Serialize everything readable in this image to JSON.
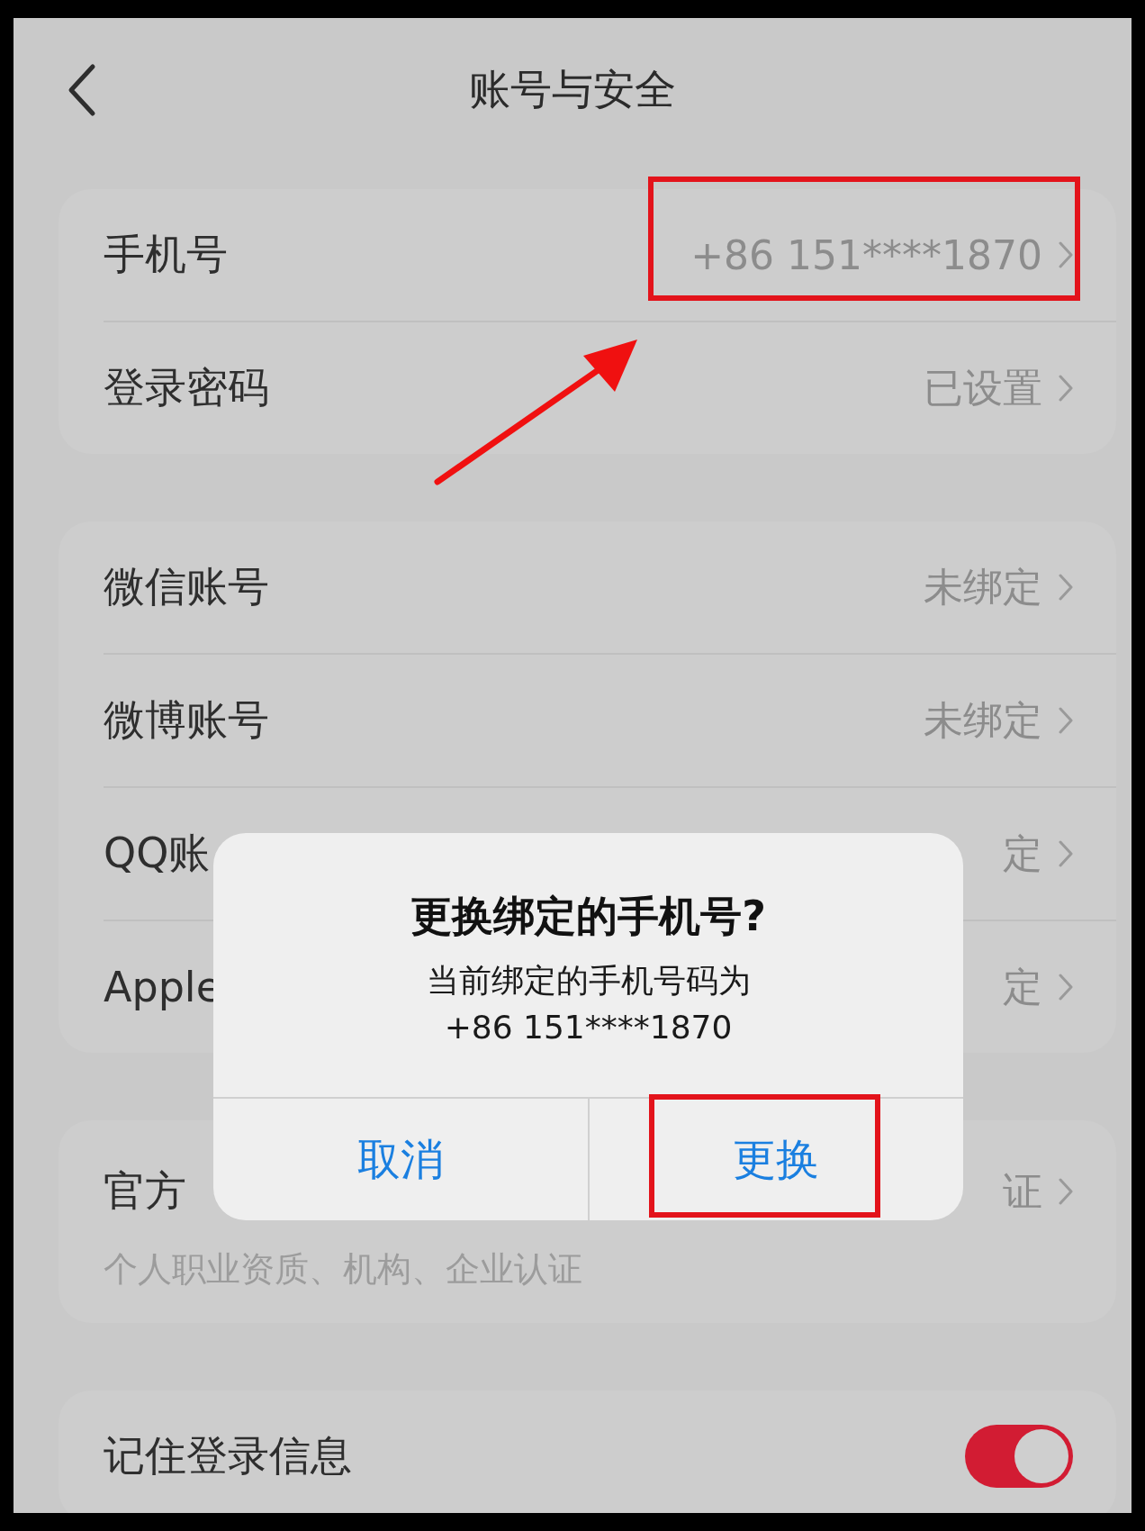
{
  "header": {
    "title": "账号与安全"
  },
  "groups": [
    {
      "rows": [
        {
          "kind": "link",
          "label": "手机号",
          "value": "+86 151****1870"
        },
        {
          "kind": "link",
          "label": "登录密码",
          "value": "已设置"
        }
      ]
    },
    {
      "rows": [
        {
          "kind": "link",
          "label": "微信账号",
          "value": "未绑定"
        },
        {
          "kind": "link",
          "label": "微博账号",
          "value": "未绑定"
        },
        {
          "kind": "link",
          "label": "QQ账",
          "value": "定"
        },
        {
          "kind": "link",
          "label": "Apple",
          "value": "定"
        }
      ]
    },
    {
      "rows": [
        {
          "kind": "link",
          "label": "官方",
          "value": "证",
          "subtitle": "个人职业资质、机构、企业认证"
        }
      ]
    },
    {
      "rows": [
        {
          "kind": "toggle",
          "label": "记住登录信息",
          "on": true
        }
      ]
    }
  ],
  "dialog": {
    "title": "更换绑定的手机号?",
    "message": "当前绑定的手机号码为",
    "phone": "+86 151****1870",
    "buttons": [
      {
        "label": "取消"
      },
      {
        "label": "更换"
      }
    ]
  }
}
